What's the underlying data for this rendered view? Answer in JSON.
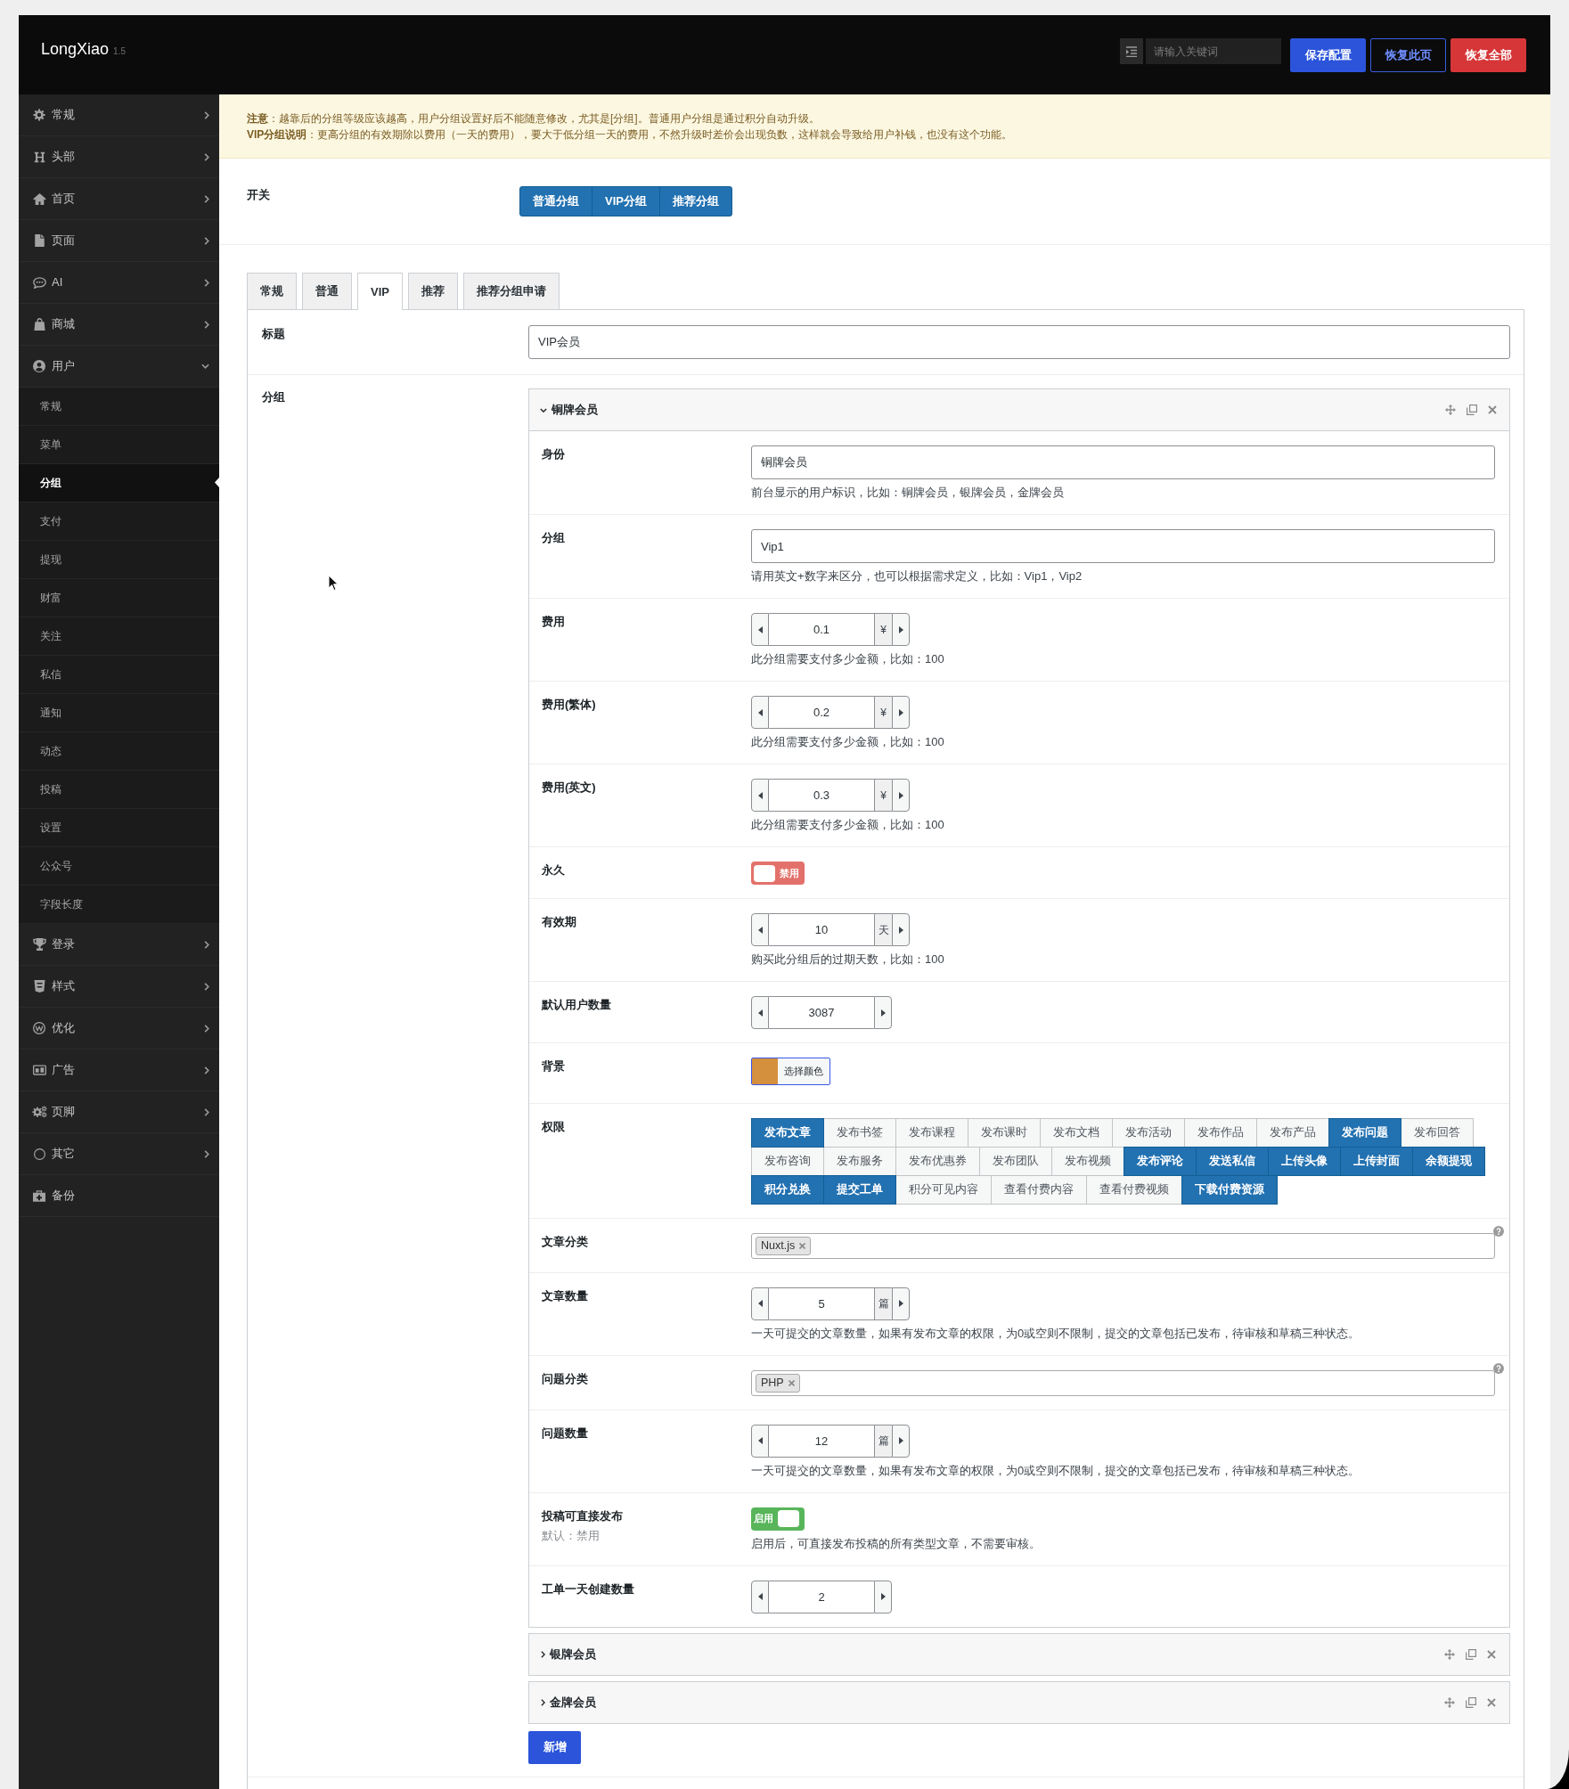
{
  "header": {
    "logo": "LongXiao",
    "version": "1.5",
    "search": {
      "placeholder": "请输入关键词"
    },
    "buttons": [
      {
        "label": "保存配置",
        "kind": "primary"
      },
      {
        "label": "恢复此页",
        "kind": "outline"
      },
      {
        "label": "恢复全部",
        "kind": "danger"
      }
    ]
  },
  "sidebar": {
    "items": [
      {
        "label": "常规",
        "kind": "group",
        "expanded": false
      },
      {
        "label": "头部",
        "kind": "group",
        "expanded": false
      },
      {
        "label": "首页",
        "kind": "group",
        "expanded": false
      },
      {
        "label": "页面",
        "kind": "group",
        "expanded": false
      },
      {
        "label": "AI",
        "kind": "group",
        "expanded": false
      },
      {
        "label": "商城",
        "kind": "group",
        "expanded": false
      },
      {
        "label": "用户",
        "kind": "group",
        "expanded": true,
        "children": [
          {
            "label": "常规",
            "selected": false
          },
          {
            "label": "菜单",
            "selected": false
          },
          {
            "label": "分组",
            "selected": true
          },
          {
            "label": "支付",
            "selected": false
          },
          {
            "label": "提现",
            "selected": false
          },
          {
            "label": "财富",
            "selected": false
          },
          {
            "label": "关注",
            "selected": false
          },
          {
            "label": "私信",
            "selected": false
          },
          {
            "label": "通知",
            "selected": false
          },
          {
            "label": "动态",
            "selected": false
          },
          {
            "label": "投稿",
            "selected": false
          },
          {
            "label": "设置",
            "selected": false
          },
          {
            "label": "公众号",
            "selected": false
          },
          {
            "label": "字段长度",
            "selected": false
          }
        ]
      },
      {
        "label": "登录",
        "kind": "group",
        "expanded": false
      },
      {
        "label": "样式",
        "kind": "group",
        "expanded": false
      },
      {
        "label": "优化",
        "kind": "group",
        "expanded": false
      },
      {
        "label": "广告",
        "kind": "group",
        "expanded": false
      },
      {
        "label": "页脚",
        "kind": "group",
        "expanded": false
      },
      {
        "label": "其它",
        "kind": "group",
        "expanded": false
      },
      {
        "label": "备份",
        "kind": "link"
      }
    ]
  },
  "notice": {
    "lines": [
      "**注意**：越靠后的分组等级应该越高，用户分组设置好后不能随意修改，尤其是[分组]。普通用户分组是通过积分自动升级。",
      "**VIP分组说明**：更高分组的有效期除以费用（一天的费用），要大于低分组一天的费用，不然升级时差价会出现负数，这样就会导致给用户补钱，也没有这个功能。"
    ]
  },
  "switch_field": {
    "label": "开关",
    "options": [
      {
        "label": "普通分组",
        "selected": true
      },
      {
        "label": "VIP分组",
        "selected": true
      },
      {
        "label": "推荐分组",
        "selected": true
      }
    ]
  },
  "tabs": [
    {
      "label": "常规",
      "selected": false
    },
    {
      "label": "普通",
      "selected": false
    },
    {
      "label": "VIP",
      "selected": true
    },
    {
      "label": "推荐",
      "selected": false
    },
    {
      "label": "推荐分组申请",
      "selected": false
    }
  ],
  "title_field": {
    "label": "标题",
    "value": "VIP会员"
  },
  "groups": {
    "label": "分组",
    "items": [
      {
        "title": "铜牌会员",
        "expanded": true,
        "fields": [
          {
            "kind": "text",
            "label": "身份",
            "value": "铜牌会员",
            "help": "前台显示的用户标识，比如：铜牌会员，银牌会员，金牌会员"
          },
          {
            "kind": "text",
            "label": "分组",
            "value": "Vip1",
            "help": "请用英文+数字来区分，也可以根据需求定义，比如：Vip1，Vip2"
          },
          {
            "kind": "spinner",
            "label": "费用",
            "value": "0.1",
            "unit": "¥",
            "help": "此分组需要支付多少金额，比如：100"
          },
          {
            "kind": "spinner",
            "label": "费用(繁体)",
            "value": "0.2",
            "unit": "¥",
            "help": "此分组需要支付多少金额，比如：100"
          },
          {
            "kind": "spinner",
            "label": "费用(英文)",
            "value": "0.3",
            "unit": "¥",
            "help": "此分组需要支付多少金额，比如：100"
          },
          {
            "kind": "switch",
            "label": "永久",
            "on": false,
            "text": "禁用"
          },
          {
            "kind": "spinner",
            "label": "有效期",
            "value": "10",
            "unit": "天",
            "help": "购买此分组后的过期天数，比如：100"
          },
          {
            "kind": "spinner",
            "label": "默认用户数量",
            "value": "3087"
          },
          {
            "kind": "color",
            "label": "背景",
            "color": "#d5903d",
            "button": "选择颜色"
          },
          {
            "kind": "buttonset",
            "label": "权限",
            "options": [
              {
                "label": "发布文章",
                "selected": true
              },
              {
                "label": "发布书签",
                "selected": false
              },
              {
                "label": "发布课程",
                "selected": false
              },
              {
                "label": "发布课时",
                "selected": false
              },
              {
                "label": "发布文档",
                "selected": false
              },
              {
                "label": "发布活动",
                "selected": false
              },
              {
                "label": "发布作品",
                "selected": false
              },
              {
                "label": "发布产品",
                "selected": false
              },
              {
                "label": "发布问题",
                "selected": true
              },
              {
                "label": "发布回答",
                "selected": false
              },
              {
                "label": "发布咨询",
                "selected": false
              },
              {
                "label": "发布服务",
                "selected": false
              },
              {
                "label": "发布优惠券",
                "selected": false
              },
              {
                "label": "发布团队",
                "selected": false
              },
              {
                "label": "发布视频",
                "selected": false
              },
              {
                "label": "发布评论",
                "selected": true
              },
              {
                "label": "发送私信",
                "selected": true
              },
              {
                "label": "上传头像",
                "selected": true
              },
              {
                "label": "上传封面",
                "selected": true
              },
              {
                "label": "余额提现",
                "selected": true
              },
              {
                "label": "积分兑换",
                "selected": true
              },
              {
                "label": "提交工单",
                "selected": true
              },
              {
                "label": "积分可见内容",
                "selected": false
              },
              {
                "label": "查看付费内容",
                "selected": false
              },
              {
                "label": "查看付费视频",
                "selected": false
              },
              {
                "label": "下载付费资源",
                "selected": true
              }
            ]
          },
          {
            "kind": "tags",
            "label": "文章分类",
            "tags": [
              "Nuxt.js"
            ]
          },
          {
            "kind": "spinner",
            "label": "文章数量",
            "value": "5",
            "unit": "篇",
            "help": "一天可提交的文章数量，如果有发布文章的权限，为0或空则不限制，提交的文章包括已发布，待审核和草稿三种状态。"
          },
          {
            "kind": "tags",
            "label": "问题分类",
            "tags": [
              "PHP"
            ]
          },
          {
            "kind": "spinner",
            "label": "问题数量",
            "value": "12",
            "unit": "篇",
            "help": "一天可提交的文章数量，如果有发布文章的权限，为0或空则不限制，提交的文章包括已发布，待审核和草稿三种状态。"
          },
          {
            "kind": "switch",
            "label": "投稿可直接发布",
            "sublabel": "默认：禁用",
            "on": true,
            "text": "启用",
            "help": "启用后，可直接发布投稿的所有类型文章，不需要审核。"
          },
          {
            "kind": "spinner",
            "label": "工单一天创建数量",
            "value": "2"
          }
        ]
      },
      {
        "title": "银牌会员",
        "expanded": false
      },
      {
        "title": "金牌会员",
        "expanded": false
      }
    ],
    "add_button": "新增"
  }
}
